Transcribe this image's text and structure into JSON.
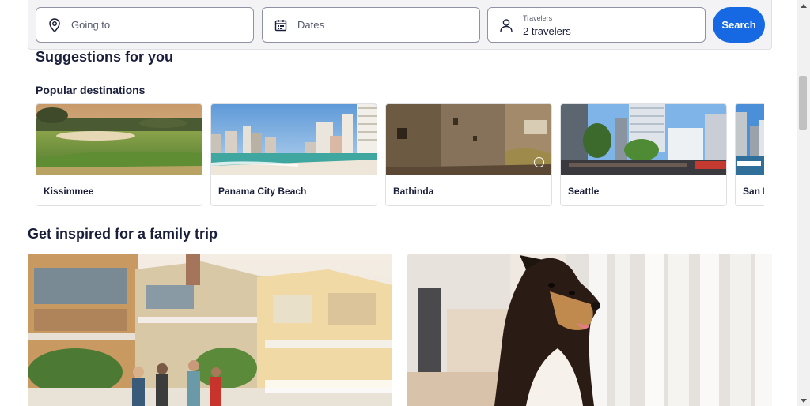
{
  "search": {
    "going_to_placeholder": "Going to",
    "dates_placeholder": "Dates",
    "travelers_label": "Travelers",
    "travelers_value": "2 travelers",
    "search_label": "Search",
    "icons": [
      "map-pin-icon",
      "calendar-icon",
      "person-icon"
    ]
  },
  "suggestions": {
    "title": "Suggestions for you",
    "subtitle": "Popular destinations",
    "destinations": [
      {
        "name": "Kissimmee"
      },
      {
        "name": "Panama City Beach"
      },
      {
        "name": "Bathinda"
      },
      {
        "name": "Seattle"
      },
      {
        "name": "San D"
      }
    ]
  },
  "inspired": {
    "title": "Get inspired for a family trip"
  },
  "colors": {
    "accent": "#1668e3",
    "text": "#191e3b",
    "border": "#dfe0e4"
  }
}
